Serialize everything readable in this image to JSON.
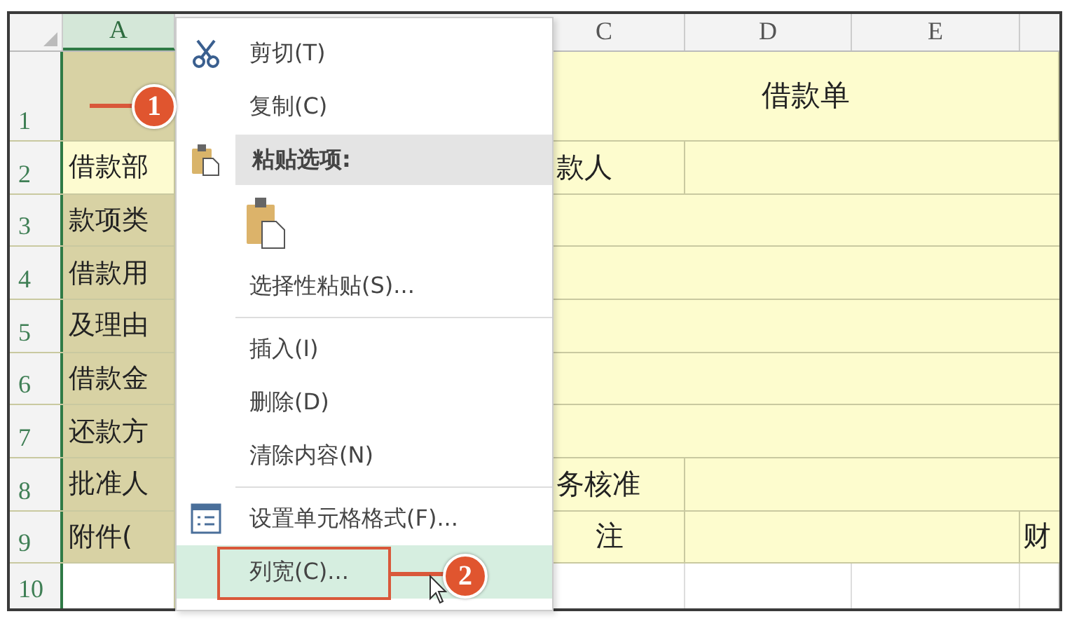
{
  "columns": [
    {
      "label": "A",
      "selected": true
    },
    {
      "label": "C",
      "selected": false
    },
    {
      "label": "D",
      "selected": false
    },
    {
      "label": "E",
      "selected": false
    }
  ],
  "rows": [
    {
      "number": "1",
      "kind": "title",
      "title": "借款单",
      "a_shaded": true
    },
    {
      "number": "2",
      "kind": "label",
      "col_a": "借款部",
      "col_c": "款人",
      "a_shaded": false
    },
    {
      "number": "3",
      "kind": "wide",
      "col_a": "款项类",
      "a_shaded": true
    },
    {
      "number": "4",
      "kind": "wide",
      "col_a": "借款用",
      "a_shaded": true
    },
    {
      "number": "5",
      "kind": "wide",
      "col_a": "及理由",
      "a_shaded": true
    },
    {
      "number": "6",
      "kind": "wide",
      "col_a": "借款金",
      "a_shaded": true
    },
    {
      "number": "7",
      "kind": "wide",
      "col_a": "还款方",
      "a_shaded": true
    },
    {
      "number": "8",
      "kind": "label",
      "col_a": "批准人",
      "col_c": "务核准",
      "a_shaded": true
    },
    {
      "number": "9",
      "kind": "label3",
      "col_a": "附件(",
      "col_c": "注",
      "col_f": "财",
      "a_shaded": true
    },
    {
      "number": "10",
      "kind": "plain",
      "a_shaded": false
    }
  ],
  "context_menu": [
    {
      "kind": "cut",
      "label": "剪切(T)",
      "selected": false
    },
    {
      "kind": "copy",
      "label": "复制(C)",
      "selected": false
    },
    {
      "kind": "header",
      "label": "粘贴选项:"
    },
    {
      "kind": "paste-option",
      "selected": false
    },
    {
      "kind": "item",
      "label": "选择性粘贴(S)...",
      "selected": false
    },
    {
      "kind": "separator"
    },
    {
      "kind": "item",
      "label": "插入(I)",
      "selected": false
    },
    {
      "kind": "item",
      "label": "删除(D)",
      "selected": false
    },
    {
      "kind": "item",
      "label": "清除内容(N)",
      "selected": false
    },
    {
      "kind": "separator"
    },
    {
      "kind": "format",
      "label": "设置单元格格式(F)...",
      "selected": false
    },
    {
      "kind": "item",
      "label": "列宽(C)...",
      "selected": true
    }
  ],
  "callouts": [
    {
      "number": "1"
    },
    {
      "number": "2"
    }
  ]
}
